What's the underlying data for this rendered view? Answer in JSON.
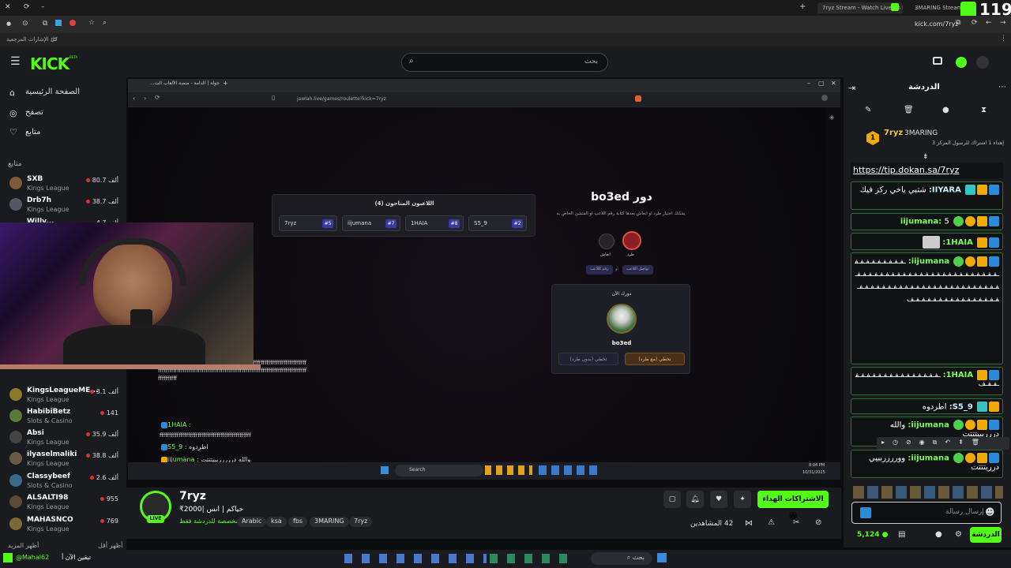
{
  "browser": {
    "tabs": [
      {
        "label": "7ryz Stream - Watch Live on Ki"
      },
      {
        "label": "3MARING Stream - W"
      }
    ],
    "url": "kick.com/7ryz",
    "bookmarks_label": "كل الإشارات المرجعية",
    "counter": "119"
  },
  "header": {
    "logo": "KICK",
    "beta": "BETA",
    "search_placeholder": "بحث"
  },
  "sidebar": {
    "nav": [
      {
        "label": "الصفحة الرئيسية",
        "icon": "home-icon"
      },
      {
        "label": "تصفح",
        "icon": "compass-icon"
      },
      {
        "label": "متابع",
        "icon": "heart-icon"
      }
    ],
    "following_title": "متابع",
    "channels_top": [
      {
        "name": "SXB",
        "cat": "Kings League",
        "count": "80.7 ألف"
      },
      {
        "name": "Drb7h",
        "cat": "Kings League",
        "count": "38.7 ألف"
      },
      {
        "name": "Willy...",
        "cat": "",
        "count": "4.7 ألف"
      }
    ],
    "channels_bottom": [
      {
        "name": "KingsLeagueME...",
        "cat": "Kings League",
        "count": "3.1 ألف"
      },
      {
        "name": "HabibiBetz",
        "cat": "Slots & Casino",
        "count": "141"
      },
      {
        "name": "Absi",
        "cat": "Kings League",
        "count": "35.9 ألف"
      },
      {
        "name": "ilyaselmaliki",
        "cat": "Kings League",
        "count": "38.8 ألف"
      },
      {
        "name": "Classybeef",
        "cat": "Slots & Casino",
        "count": "2.6 ألف"
      },
      {
        "name": "ALSALTI98",
        "cat": "Kings League",
        "count": "955"
      },
      {
        "name": "MAHASNCO",
        "cat": "Kings League",
        "count": "769"
      }
    ],
    "show_more": "أظهر المزيد",
    "show_less": "أظهر أقل"
  },
  "inner_browser": {
    "tab": "جولة | الدامة - منصة الألعاب الت...",
    "url": "jawlah.live/games/roulette?kick=7ryz"
  },
  "game": {
    "waiting_title": "اللاعبون المتاحون (4)",
    "players": [
      {
        "name": "7ryz",
        "num": "#5"
      },
      {
        "name": "iijumana",
        "num": "#7"
      },
      {
        "name": "1HAIA",
        "num": "#8"
      },
      {
        "name": "S5_9",
        "num": "#2"
      }
    ],
    "turn_title": "دور bo3ed",
    "turn_desc": "يمكنك اختيار طرد او انعاش بعدها كتابة رقم اللاعب او المنشن الخاص به",
    "opt_kick": "طرد",
    "opt_revive": "انعاش",
    "opt_tag1": "رقم اللاعب",
    "opt_or": "او",
    "opt_tag2": "تواصل اللاعب",
    "your_turn": "دورك الآن",
    "player_name": "bo3ed",
    "skip_with": "تخطي (مع طرد)",
    "skip_without": "تخطي (بدون طرد)"
  },
  "overlay_chat": [
    {
      "user": "1HAIA :",
      "text": ""
    },
    {
      "user": "S5_9 :",
      "text": "اطردوه"
    },
    {
      "user": "iijumana :",
      "text": "والله درررررببيتتتت"
    },
    {
      "user": "iijumana :",
      "text": "ووررررببيي درريتتت"
    }
  ],
  "taskbar_inner": {
    "search": "Search",
    "time": "8:04 PM",
    "date": "10/31/2025"
  },
  "stream": {
    "channel": "7ryz",
    "live_badge": "LIVE",
    "title": "حياكم | انس |2000₹",
    "subtitle": "مخصصة للدردشة فقط",
    "tags": [
      "Arabic",
      "ksa",
      "fbs",
      "3MARING",
      "7ryz"
    ],
    "viewers_label": "المشاهدين",
    "viewers": "42",
    "gift_button": "الاشتراكات الهداء"
  },
  "chat": {
    "title": "الدردشة",
    "pinned_user": "7ryz",
    "pinned_rank": "1",
    "pinned_channel": "3MARING",
    "pinned_desc": "إهداء 1 اشتراك للرسول المركز 3",
    "link": "https://tip.dokan.sa/7ryz",
    "messages": [
      {
        "user": "IIYARA:",
        "text": "شتبي ياخي ركز فيك"
      },
      {
        "user": "iijumana:",
        "text": "5"
      },
      {
        "user": "1HAIA:",
        "text": ""
      },
      {
        "user": "iijumana:",
        "text": "ـفـفـفـفـفـفـفـفـفـفـفـفـفـفـفـفـفـفـفـفـفـفـفـفـفـفـفـفـفـفـفـفـفـفـفـفـفـفـفـفـفـفـفـفـفـفـفـفـفـفـفـفـفـفـفـفـفـفـفـفـفـفـفـفـفـفـفـفـفـفـفـفـفـفـف"
      },
      {
        "user": "1HAIA:",
        "text": "ـفـفـفـفـفـفـفـفـفـفـفـفـفـفـفـفـفـف"
      },
      {
        "user": "S5_9:",
        "text": "اطردوه"
      },
      {
        "user": "iijumana:",
        "text": "والله درررببيتتتت"
      },
      {
        "user": "iijumana:",
        "text": "ووررررببيي درريتتتت"
      }
    ],
    "input_placeholder": "إرسال رسالة",
    "send_button": "الدردشة",
    "points": "5,124"
  },
  "win_taskbar": {
    "left_text": "تبقين الآن أ",
    "user": "@Mahal62",
    "search": "بحث"
  }
}
